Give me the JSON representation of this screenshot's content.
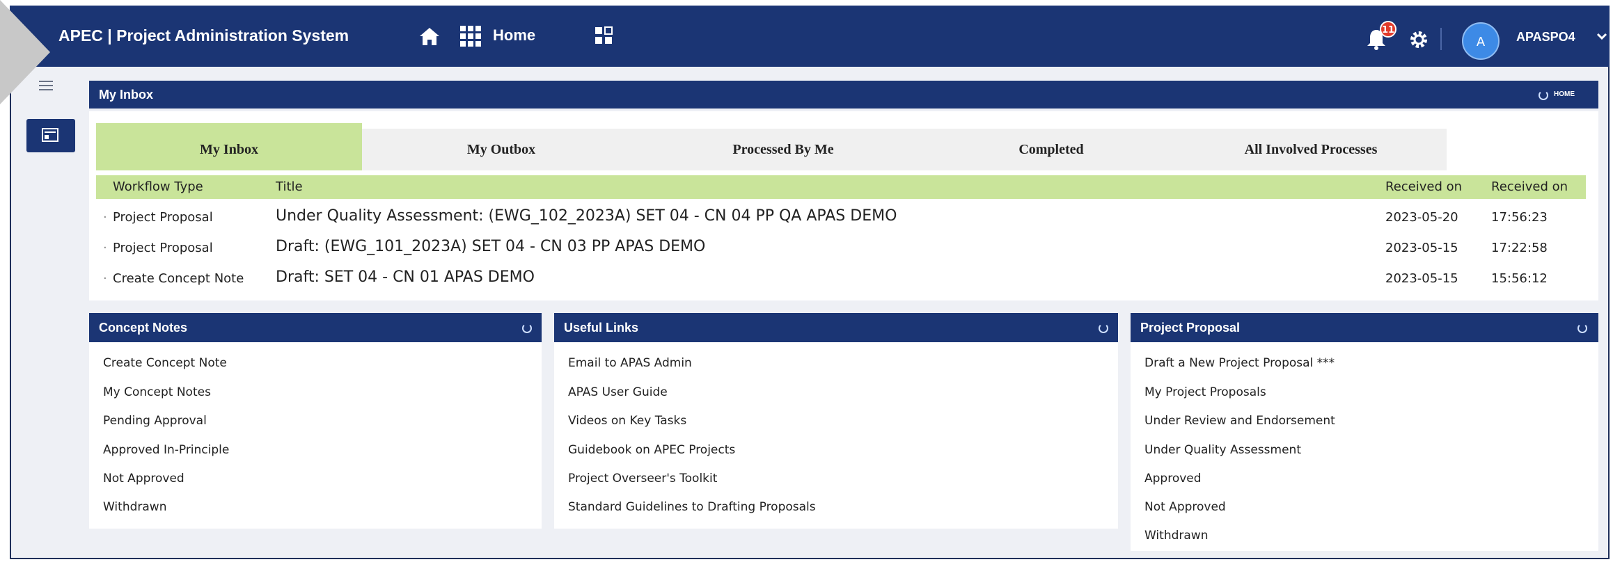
{
  "app": {
    "title": "APEC | Project Administration System",
    "home_label": "Home",
    "user": "APASPO4",
    "avatar_letter": "A",
    "notifications": "11"
  },
  "inbox": {
    "header": "My Inbox",
    "header_right": "HOME",
    "tabs": [
      "My Inbox",
      "My Outbox",
      "Processed By Me",
      "Completed",
      "All Involved Processes"
    ],
    "columns": {
      "type": "Workflow Type",
      "title": "Title",
      "received_date": "Received on",
      "received_time": "Received on"
    },
    "rows": [
      {
        "type": "Project Proposal",
        "title": "Under Quality Assessment: (EWG_102_2023A) SET 04 - CN 04 PP QA APAS DEMO",
        "date": "2023-05-20",
        "time": "17:56:23"
      },
      {
        "type": "Project Proposal",
        "title": "Draft: (EWG_101_2023A) SET 04 - CN 03 PP APAS DEMO",
        "date": "2023-05-15",
        "time": "17:22:58"
      },
      {
        "type": "Create Concept Note",
        "title": "Draft: SET 04 - CN 01 APAS DEMO",
        "date": "2023-05-15",
        "time": "15:56:12"
      }
    ]
  },
  "concept_notes": {
    "header": "Concept Notes",
    "links": [
      "Create Concept Note",
      "My Concept Notes",
      "Pending Approval",
      "Approved In-Principle",
      "Not Approved",
      "Withdrawn"
    ]
  },
  "useful_links": {
    "header": "Useful Links",
    "links": [
      "Email to APAS Admin",
      "APAS User Guide",
      "Videos on Key Tasks",
      "Guidebook on APEC Projects",
      "Project Overseer's Toolkit",
      "Standard Guidelines to Drafting Proposals"
    ]
  },
  "project_proposal": {
    "header": "Project Proposal",
    "links": [
      "Draft a New Project Proposal ***",
      "My Project Proposals",
      "Under Review and Endorsement",
      "Under Quality Assessment",
      "Approved",
      "Not Approved",
      "Withdrawn"
    ]
  },
  "colors": {
    "nav": "#1b3574",
    "tab_active": "#c9e49a",
    "badge": "#e23b2b"
  }
}
